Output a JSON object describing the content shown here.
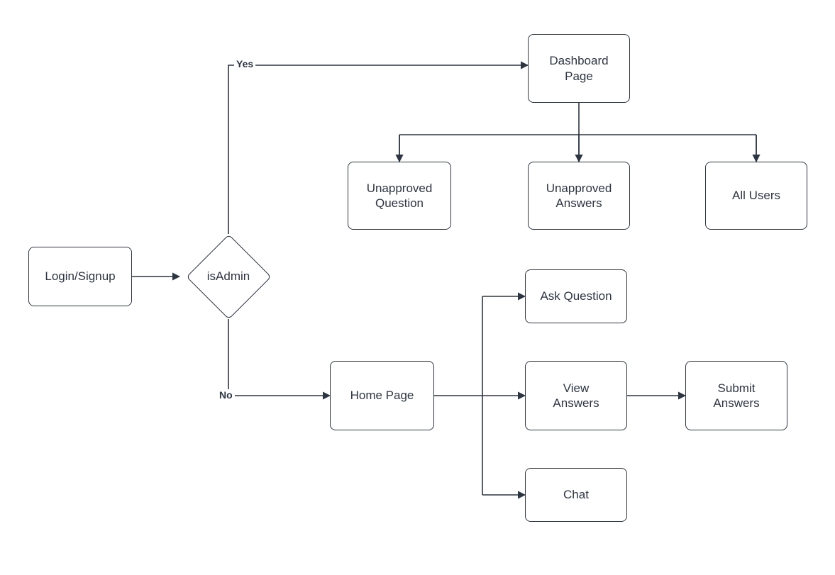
{
  "chart_data": {
    "type": "flowchart",
    "title": "",
    "nodes": [
      {
        "id": "login",
        "shape": "rect",
        "label": "Login/Signup"
      },
      {
        "id": "isadmin",
        "shape": "diamond",
        "label": "isAdmin"
      },
      {
        "id": "dashboard",
        "shape": "rect",
        "label": "Dashboard Page"
      },
      {
        "id": "unapp_q",
        "shape": "rect",
        "label": "Unapproved Question"
      },
      {
        "id": "unapp_a",
        "shape": "rect",
        "label": "Unapproved Answers"
      },
      {
        "id": "all_users",
        "shape": "rect",
        "label": "All Users"
      },
      {
        "id": "home",
        "shape": "rect",
        "label": "Home Page"
      },
      {
        "id": "ask_q",
        "shape": "rect",
        "label": "Ask Question"
      },
      {
        "id": "view_a",
        "shape": "rect",
        "label": "View Answers"
      },
      {
        "id": "chat",
        "shape": "rect",
        "label": "Chat"
      },
      {
        "id": "submit_a",
        "shape": "rect",
        "label": "Submit Answers"
      }
    ],
    "edges": [
      {
        "from": "login",
        "to": "isadmin",
        "label": ""
      },
      {
        "from": "isadmin",
        "to": "dashboard",
        "label": "Yes"
      },
      {
        "from": "isadmin",
        "to": "home",
        "label": "No"
      },
      {
        "from": "dashboard",
        "to": "unapp_q",
        "label": ""
      },
      {
        "from": "dashboard",
        "to": "unapp_a",
        "label": ""
      },
      {
        "from": "dashboard",
        "to": "all_users",
        "label": ""
      },
      {
        "from": "home",
        "to": "ask_q",
        "label": ""
      },
      {
        "from": "home",
        "to": "view_a",
        "label": ""
      },
      {
        "from": "home",
        "to": "chat",
        "label": ""
      },
      {
        "from": "view_a",
        "to": "submit_a",
        "label": ""
      }
    ]
  },
  "labels": {
    "login": "Login/Signup",
    "isadmin": "isAdmin",
    "dashboard": "Dashboard\nPage",
    "unapp_q": "Unapproved\nQuestion",
    "unapp_a": "Unapproved\nAnswers",
    "all_users": "All Users",
    "home": "Home Page",
    "ask_q": "Ask Question",
    "view_a": "View\nAnswers",
    "chat": "Chat",
    "submit_a": "Submit\nAnswers",
    "yes": "Yes",
    "no": "No"
  }
}
